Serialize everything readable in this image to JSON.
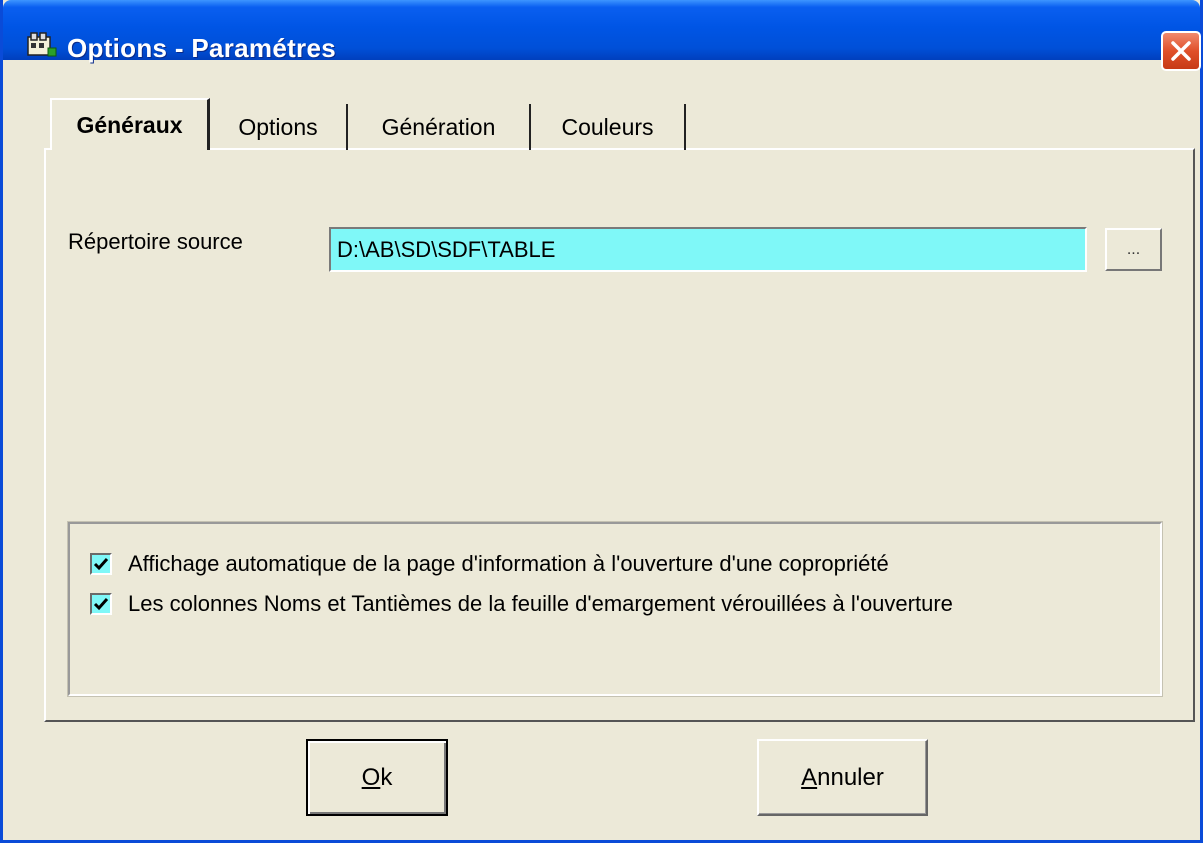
{
  "window": {
    "title": "Options - Paramétres",
    "icon": "app-icon",
    "close_icon": "close-icon"
  },
  "tabs": [
    {
      "label": "Généraux",
      "active": true
    },
    {
      "label": "Options",
      "active": false
    },
    {
      "label": "Génération",
      "active": false
    },
    {
      "label": "Couleurs",
      "active": false
    }
  ],
  "source": {
    "label": "Répertoire source",
    "value": "D:\\AB\\SD\\SDF\\TABLE",
    "browse_label": "..."
  },
  "checkboxes": [
    {
      "label": "Affichage automatique de la page d'information à l'ouverture d'une copropriété",
      "checked": true
    },
    {
      "label": "Les colonnes Noms et Tantièmes de la feuille d'emargement vérouillées à l'ouverture",
      "checked": true
    }
  ],
  "buttons": {
    "ok_first": "O",
    "ok_rest": "k",
    "cancel_first": "A",
    "cancel_rest": "nnuler"
  },
  "colors": {
    "titlebar": "#0055e5",
    "input_bg": "#7ff8f8",
    "face": "#ece9d8"
  }
}
